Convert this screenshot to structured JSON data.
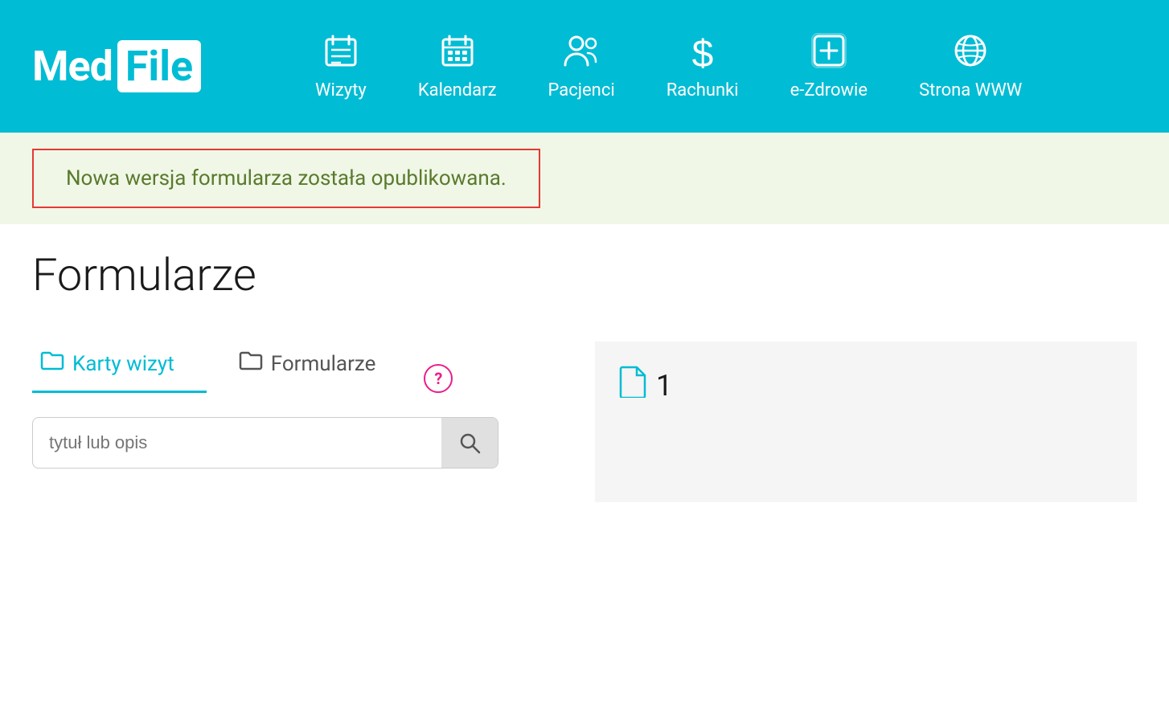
{
  "header": {
    "logo_med": "Med",
    "logo_file": "File",
    "nav_items": [
      {
        "id": "wizyty",
        "label": "Wizyty",
        "icon": "📋"
      },
      {
        "id": "kalendarz",
        "label": "Kalendarz",
        "icon": "📅"
      },
      {
        "id": "pacjenci",
        "label": "Pacjenci",
        "icon": "👥"
      },
      {
        "id": "rachunki",
        "label": "Rachunki",
        "icon": "💲"
      },
      {
        "id": "e-zdrowie",
        "label": "e-Zdrowie",
        "icon": "🏥"
      },
      {
        "id": "strona-www",
        "label": "Strona WWW",
        "icon": "🌐"
      }
    ]
  },
  "notification": {
    "text": "Nowa wersja formularza została opublikowana."
  },
  "page": {
    "title": "Formularze"
  },
  "tabs": [
    {
      "id": "karty-wizyt",
      "label": "Karty wizyt",
      "active": true
    },
    {
      "id": "formularze",
      "label": "Formularze",
      "active": false
    }
  ],
  "search": {
    "placeholder": "tytuł lub opis"
  },
  "right_panel": {
    "doc_count": "1"
  },
  "icons": {
    "folder": "🗂",
    "search": "🔍",
    "document": "📄",
    "help": "?"
  }
}
